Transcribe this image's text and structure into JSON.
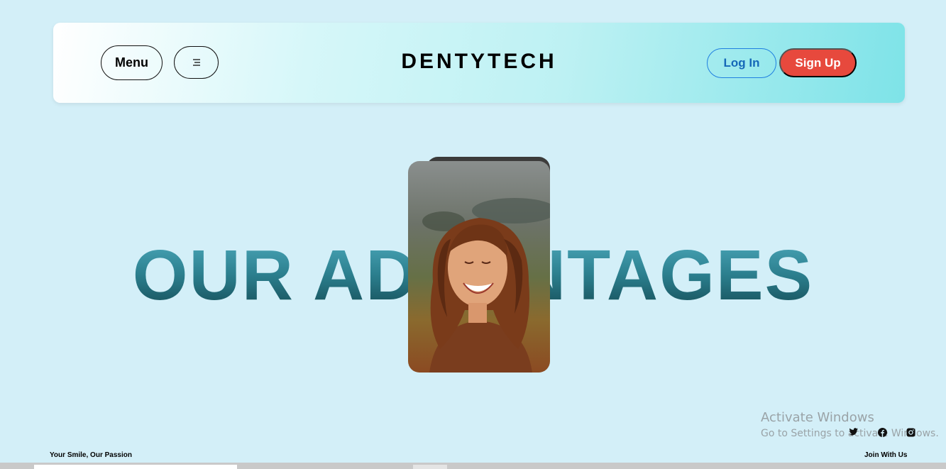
{
  "header": {
    "menu_label": "Menu",
    "menu_icon": "list-icon",
    "brand": "DENTYTECH",
    "login_label": "Log In",
    "signup_label": "Sign Up"
  },
  "hero": {
    "title": "OUR ADVANTAGES"
  },
  "watermark": {
    "line1": "Activate Windows",
    "line2": "Go to Settings to activate Windows."
  },
  "social": [
    "twitter-icon",
    "facebook-icon",
    "instagram-icon"
  ],
  "footer": {
    "tagline": "Your Smile, Our Passion",
    "join": "Join With Us"
  },
  "colors": {
    "background": "#d3eff8",
    "signup": "#e7493d",
    "login": "#1568b8",
    "title_top": "#4aa6b8",
    "title_bottom": "#164e58"
  }
}
